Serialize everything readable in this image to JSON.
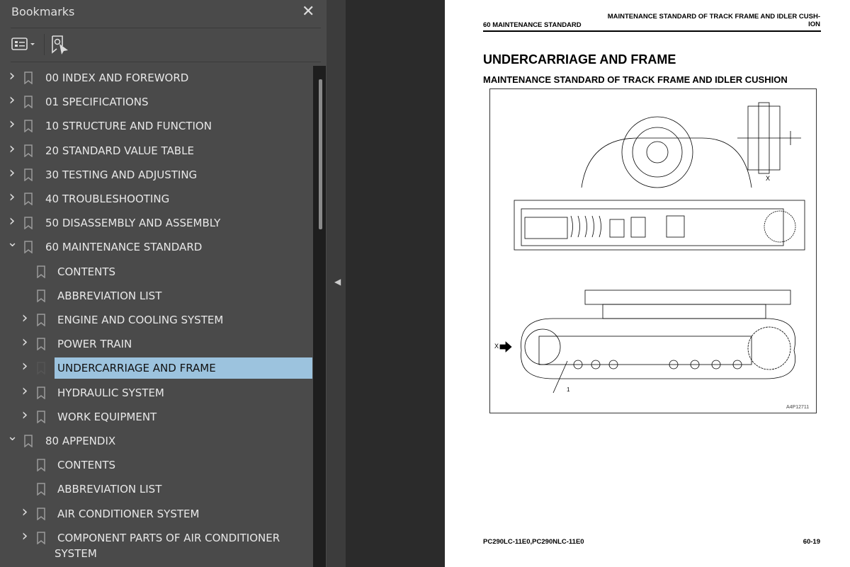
{
  "sidebar": {
    "title": "Bookmarks",
    "close_icon": "close-icon",
    "toolbar": {
      "options_icon": "list-options-icon",
      "find_icon": "find-bookmark-icon"
    },
    "items": [
      {
        "label": "00 INDEX AND FOREWORD",
        "level": 0,
        "state": "collapsed"
      },
      {
        "label": "01 SPECIFICATIONS",
        "level": 0,
        "state": "collapsed"
      },
      {
        "label": "10 STRUCTURE AND FUNCTION",
        "level": 0,
        "state": "collapsed"
      },
      {
        "label": "20 STANDARD VALUE TABLE",
        "level": 0,
        "state": "collapsed"
      },
      {
        "label": "30 TESTING AND ADJUSTING",
        "level": 0,
        "state": "collapsed"
      },
      {
        "label": "40 TROUBLESHOOTING",
        "level": 0,
        "state": "collapsed"
      },
      {
        "label": "50 DISASSEMBLY AND ASSEMBLY",
        "level": 0,
        "state": "collapsed"
      },
      {
        "label": "60 MAINTENANCE STANDARD",
        "level": 0,
        "state": "expanded"
      },
      {
        "label": "CONTENTS",
        "level": 1,
        "state": "leaf"
      },
      {
        "label": "ABBREVIATION LIST",
        "level": 1,
        "state": "leaf"
      },
      {
        "label": "ENGINE AND COOLING SYSTEM",
        "level": 1,
        "state": "collapsed"
      },
      {
        "label": "POWER TRAIN",
        "level": 1,
        "state": "collapsed"
      },
      {
        "label": "UNDERCARRIAGE AND FRAME",
        "level": 1,
        "state": "collapsed",
        "selected": true
      },
      {
        "label": "HYDRAULIC SYSTEM",
        "level": 1,
        "state": "collapsed"
      },
      {
        "label": "WORK EQUIPMENT",
        "level": 1,
        "state": "collapsed"
      },
      {
        "label": "80 APPENDIX",
        "level": 0,
        "state": "expanded"
      },
      {
        "label": "CONTENTS",
        "level": 1,
        "state": "leaf"
      },
      {
        "label": "ABBREVIATION LIST",
        "level": 1,
        "state": "leaf"
      },
      {
        "label": "AIR CONDITIONER SYSTEM",
        "level": 1,
        "state": "collapsed"
      },
      {
        "label": "COMPONENT PARTS OF AIR CONDITIONER SYSTEM",
        "level": 1,
        "state": "collapsed",
        "wrap": [
          "COMPONENT PARTS OF AIR CONDITIONER",
          "SYSTEM"
        ]
      }
    ],
    "selected_color": "#9cc3de"
  },
  "page": {
    "header_left": "60 MAINTENANCE STANDARD",
    "header_right_1": "MAINTENANCE STANDARD OF TRACK FRAME AND IDLER CUSH-",
    "header_right_2": "ION",
    "title": "UNDERCARRIAGE AND FRAME",
    "subtitle": "MAINTENANCE STANDARD OF TRACK FRAME AND IDLER CUSHION",
    "figure_labels": {
      "view": "X",
      "arrow": "X",
      "callout": "1",
      "code": "A4P12711"
    },
    "footer_left": "PC290LC-11E0,PC290NLC-11E0",
    "footer_right": "60-19"
  }
}
